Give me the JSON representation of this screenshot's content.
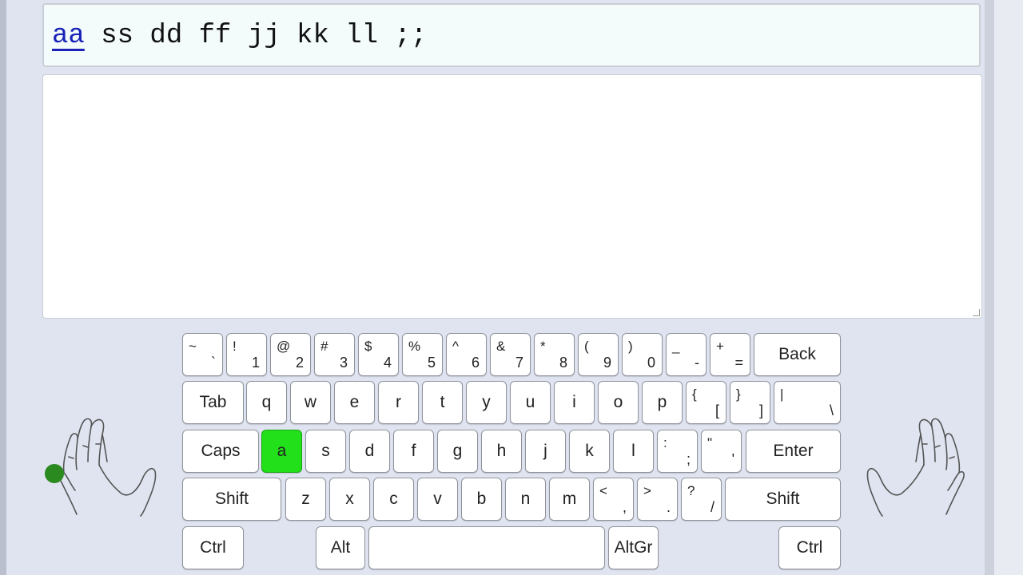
{
  "lesson": {
    "current_group": "aa",
    "remaining_text": " ss dd ff jj kk ll ;;"
  },
  "input": {
    "value": ""
  },
  "keyboard": {
    "active_key": "a",
    "active_color": "#22e01a",
    "finger_dot_color": "#2a8a1f",
    "rows": [
      [
        {
          "top": "~",
          "bot": "`"
        },
        {
          "top": "!",
          "bot": "1"
        },
        {
          "top": "@",
          "bot": "2"
        },
        {
          "top": "#",
          "bot": "3"
        },
        {
          "top": "$",
          "bot": "4"
        },
        {
          "top": "%",
          "bot": "5"
        },
        {
          "top": "^",
          "bot": "6"
        },
        {
          "top": "&",
          "bot": "7"
        },
        {
          "top": "*",
          "bot": "8"
        },
        {
          "top": "(",
          "bot": "9"
        },
        {
          "top": ")",
          "bot": "0"
        },
        {
          "top": "_",
          "bot": "-"
        },
        {
          "top": "+",
          "bot": "="
        },
        {
          "label": "Back"
        }
      ],
      [
        {
          "label": "Tab"
        },
        {
          "label": "q"
        },
        {
          "label": "w"
        },
        {
          "label": "e"
        },
        {
          "label": "r"
        },
        {
          "label": "t"
        },
        {
          "label": "y"
        },
        {
          "label": "u"
        },
        {
          "label": "i"
        },
        {
          "label": "o"
        },
        {
          "label": "p"
        },
        {
          "top": "{",
          "bot": "["
        },
        {
          "top": "}",
          "bot": "]"
        },
        {
          "top": "|",
          "bot": "\\"
        }
      ],
      [
        {
          "label": "Caps"
        },
        {
          "label": "a"
        },
        {
          "label": "s"
        },
        {
          "label": "d"
        },
        {
          "label": "f"
        },
        {
          "label": "g"
        },
        {
          "label": "h"
        },
        {
          "label": "j"
        },
        {
          "label": "k"
        },
        {
          "label": "l"
        },
        {
          "top": ":",
          "bot": ";"
        },
        {
          "top": "\"",
          "bot": "'"
        },
        {
          "label": "Enter"
        }
      ],
      [
        {
          "label": "Shift"
        },
        {
          "label": "z"
        },
        {
          "label": "x"
        },
        {
          "label": "c"
        },
        {
          "label": "v"
        },
        {
          "label": "b"
        },
        {
          "label": "n"
        },
        {
          "label": "m"
        },
        {
          "top": "<",
          "bot": ","
        },
        {
          "top": ">",
          "bot": "."
        },
        {
          "top": "?",
          "bot": "/"
        },
        {
          "label": "Shift"
        }
      ],
      [
        {
          "label": "Ctrl"
        },
        {
          "label": "Alt"
        },
        {
          "label": ""
        },
        {
          "label": "AltGr"
        },
        {
          "label": "Ctrl"
        }
      ]
    ]
  },
  "hands": {
    "left": "left-hand-icon",
    "right": "right-hand-icon"
  }
}
